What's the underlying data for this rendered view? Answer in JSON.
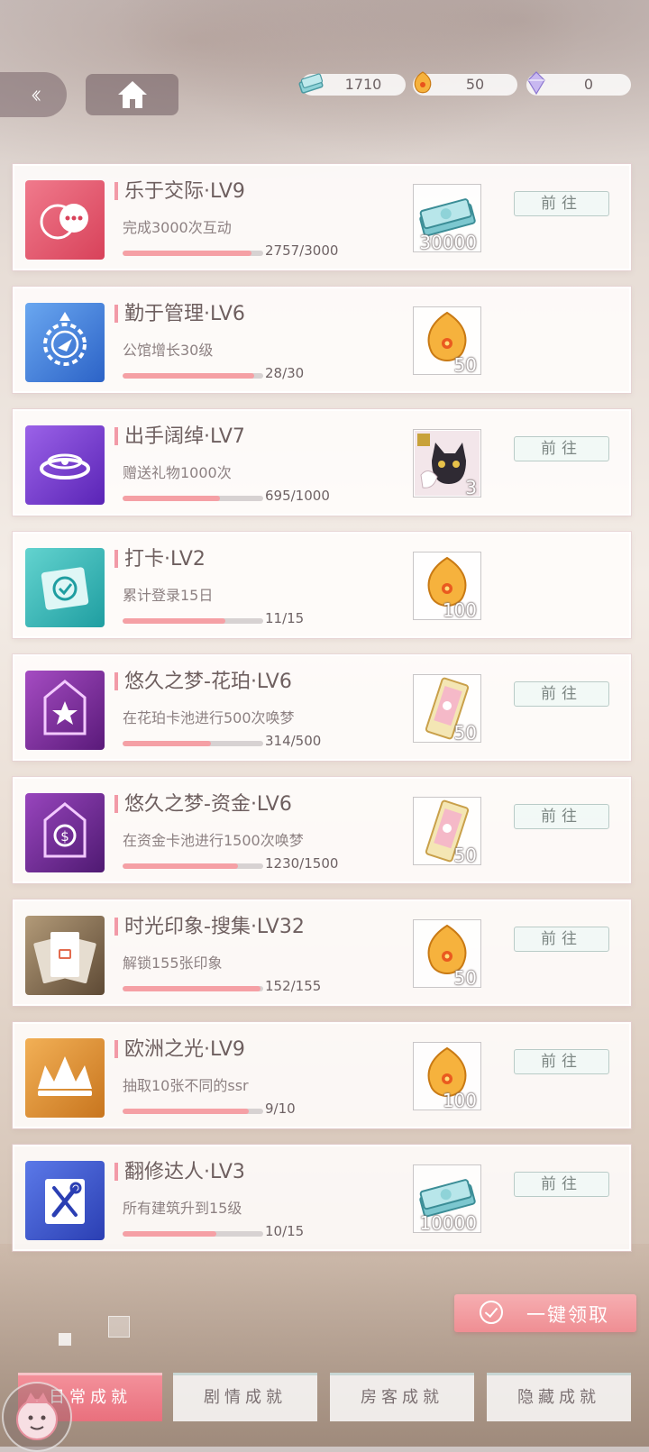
{
  "header": {
    "back_icon": "double-chevron-left-icon",
    "home_icon": "home-icon",
    "currencies": [
      {
        "icon": "cash-stack-icon",
        "value": "1710"
      },
      {
        "icon": "amber-gem-icon",
        "value": "50"
      },
      {
        "icon": "crystal-icon",
        "value": "0"
      }
    ]
  },
  "achievements": [
    {
      "title": "乐于交际·LV9",
      "desc": "完成3000次互动",
      "progress": "2757/3000",
      "ratio": 0.919,
      "reward_icon": "cash-stack-icon",
      "reward_qty": "30000",
      "action": "前往",
      "icon": "chat-bubbles-icon",
      "color": "#e0566a"
    },
    {
      "title": "勤于管理·LV6",
      "desc": "公馆增长30级",
      "progress": "28/30",
      "ratio": 0.933,
      "reward_icon": "amber-gem-icon",
      "reward_qty": "50",
      "action": "",
      "icon": "gear-compass-icon",
      "color": "#3c78d8"
    },
    {
      "title": "出手阔绰·LV7",
      "desc": "赠送礼物1000次",
      "progress": "695/1000",
      "ratio": 0.695,
      "reward_icon": "cat-avatar-frame-icon",
      "reward_qty": "3",
      "action": "前往",
      "icon": "gift-ring-icon",
      "color": "#7a3fd1"
    },
    {
      "title": "打卡·LV2",
      "desc": "累计登录15日",
      "progress": "11/15",
      "ratio": 0.733,
      "reward_icon": "amber-gem-icon",
      "reward_qty": "100",
      "action": "",
      "icon": "checkin-calendar-icon",
      "color": "#2fb6b4"
    },
    {
      "title": "悠久之梦-花珀·LV6",
      "desc": "在花珀卡池进行500次唤梦",
      "progress": "314/500",
      "ratio": 0.628,
      "reward_icon": "summon-ticket-icon",
      "reward_qty": "50",
      "action": "前往",
      "icon": "star-badge-icon",
      "color": "#8a2fa8"
    },
    {
      "title": "悠久之梦-资金·LV6",
      "desc": "在资金卡池进行1500次唤梦",
      "progress": "1230/1500",
      "ratio": 0.82,
      "reward_icon": "summon-ticket-icon",
      "reward_qty": "50",
      "action": "前往",
      "icon": "coin-badge-icon",
      "color": "#6f2d9c"
    },
    {
      "title": "时光印象-搜集·LV32",
      "desc": "解锁155张印象",
      "progress": "152/155",
      "ratio": 0.98,
      "reward_icon": "amber-gem-icon",
      "reward_qty": "50",
      "action": "前往",
      "icon": "photo-cards-icon",
      "color": "#8a6e52"
    },
    {
      "title": "欧洲之光·LV9",
      "desc": "抽取10张不同的ssr",
      "progress": "9/10",
      "ratio": 0.9,
      "reward_icon": "amber-gem-icon",
      "reward_qty": "100",
      "action": "前往",
      "icon": "crown-icon",
      "color": "#e2952e"
    },
    {
      "title": "翻修达人·LV3",
      "desc": "所有建筑升到15级",
      "progress": "10/15",
      "ratio": 0.667,
      "reward_icon": "cash-stack-icon",
      "reward_qty": "10000",
      "action": "前往",
      "icon": "tools-icon",
      "color": "#3d54c8"
    }
  ],
  "claim_all": {
    "label": "一键领取",
    "icon": "check-circle-icon"
  },
  "tabs": [
    {
      "label": "日常成就",
      "active": true
    },
    {
      "label": "剧情成就",
      "active": false
    },
    {
      "label": "房客成就",
      "active": false
    },
    {
      "label": "隐藏成就",
      "active": false
    }
  ],
  "avatar_icon": "mascot-avatar-icon"
}
